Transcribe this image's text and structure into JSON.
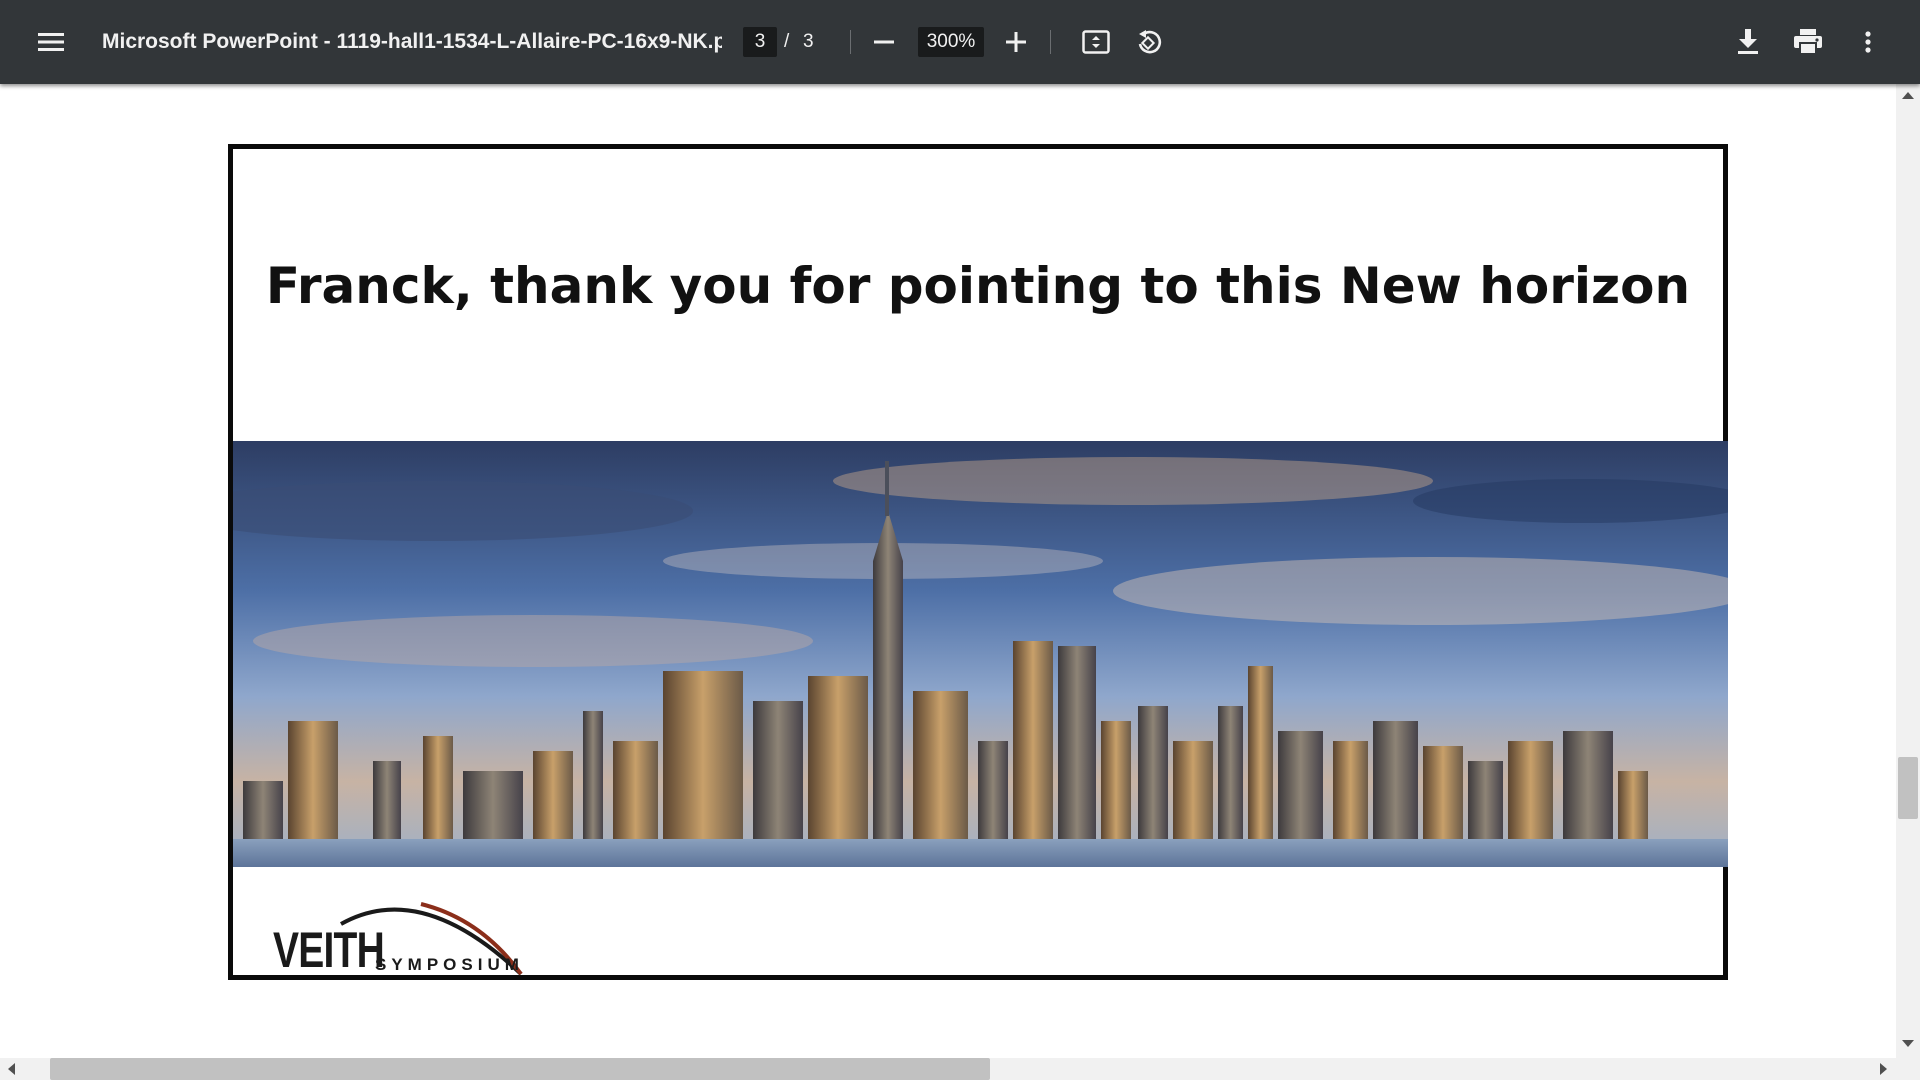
{
  "toolbar": {
    "menu_icon": "hamburger-menu-icon",
    "title": "Microsoft PowerPoint - 1119-hall1-1534-L-Allaire-PC-16x9-NK.p...",
    "current_page": "3",
    "page_separator": "/",
    "total_pages": "3",
    "zoom_level": "300%",
    "icons": [
      "zoom-out-icon",
      "zoom-in-icon",
      "fit-to-page-icon",
      "rotate-icon",
      "download-icon",
      "print-icon",
      "more-options-icon"
    ]
  },
  "slide": {
    "title": "Franck, thank you for pointing to this New horizon",
    "image": "city-skyline-photo",
    "logo": {
      "word": "VEITH",
      "sub": "SYMPOSIUM"
    }
  },
  "colors": {
    "toolbar_bg": "#323639",
    "toolbar_text": "#f1f1f1",
    "slide_border": "#0a0a0a",
    "logo_arc": "#8b2e1a"
  }
}
